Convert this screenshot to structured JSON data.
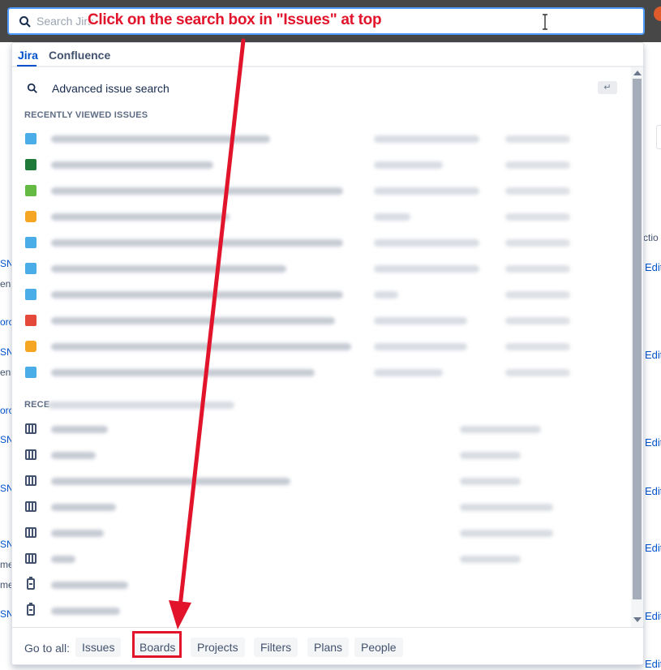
{
  "search": {
    "placeholder": "Search Jira"
  },
  "tabs": [
    {
      "label": "Jira",
      "active": true
    },
    {
      "label": "Confluence",
      "active": false
    }
  ],
  "advanced": {
    "label": "Advanced issue search",
    "icon": "search-icon",
    "enter_glyph": "↵"
  },
  "recent_issues_heading": "RECENTLY VIEWED ISSUES",
  "recent_boards_heading": "RECE",
  "issue_type_icons": [
    {
      "icon": "task-icon",
      "color": "#4bade8"
    },
    {
      "icon": "epic-icon",
      "color": "#1f7a3a"
    },
    {
      "icon": "new-feature-icon",
      "color": "#65ba43"
    },
    {
      "icon": "idea-icon",
      "color": "#f5a623"
    },
    {
      "icon": "subtask-icon",
      "color": "#4bade8"
    },
    {
      "icon": "task-icon",
      "color": "#4bade8"
    },
    {
      "icon": "task-icon",
      "color": "#4bade8"
    },
    {
      "icon": "bug-icon",
      "color": "#e5493a"
    },
    {
      "icon": "idea-icon",
      "color": "#f5a623"
    },
    {
      "icon": "task-icon",
      "color": "#4bade8"
    }
  ],
  "board_icons": [
    "board-icon",
    "board-icon",
    "board-icon",
    "board-icon",
    "board-icon",
    "board-icon",
    "clipboard-icon",
    "clipboard-icon"
  ],
  "footer": {
    "goto_label": "Go to all:",
    "links": [
      "Issues",
      "Boards",
      "Projects",
      "Filters",
      "Plans",
      "People"
    ]
  },
  "background": {
    "left_fragments": [
      "SN",
      "en",
      "orc",
      "SN",
      "en",
      "orc",
      "SN",
      "SN",
      "SN",
      "me",
      "me",
      "SN"
    ],
    "right_header": "ctio",
    "right_edit": [
      "Edit",
      "Edit",
      "Edit",
      "Edit",
      "Edit",
      "Edit",
      "Edit"
    ]
  },
  "annotation": {
    "text": "Click on the search box in \"Issues\" at top",
    "color": "#e2142b"
  },
  "colors": {
    "accent": "#0052cc",
    "focus_ring": "#4c9aff",
    "topbar": "#474747"
  }
}
